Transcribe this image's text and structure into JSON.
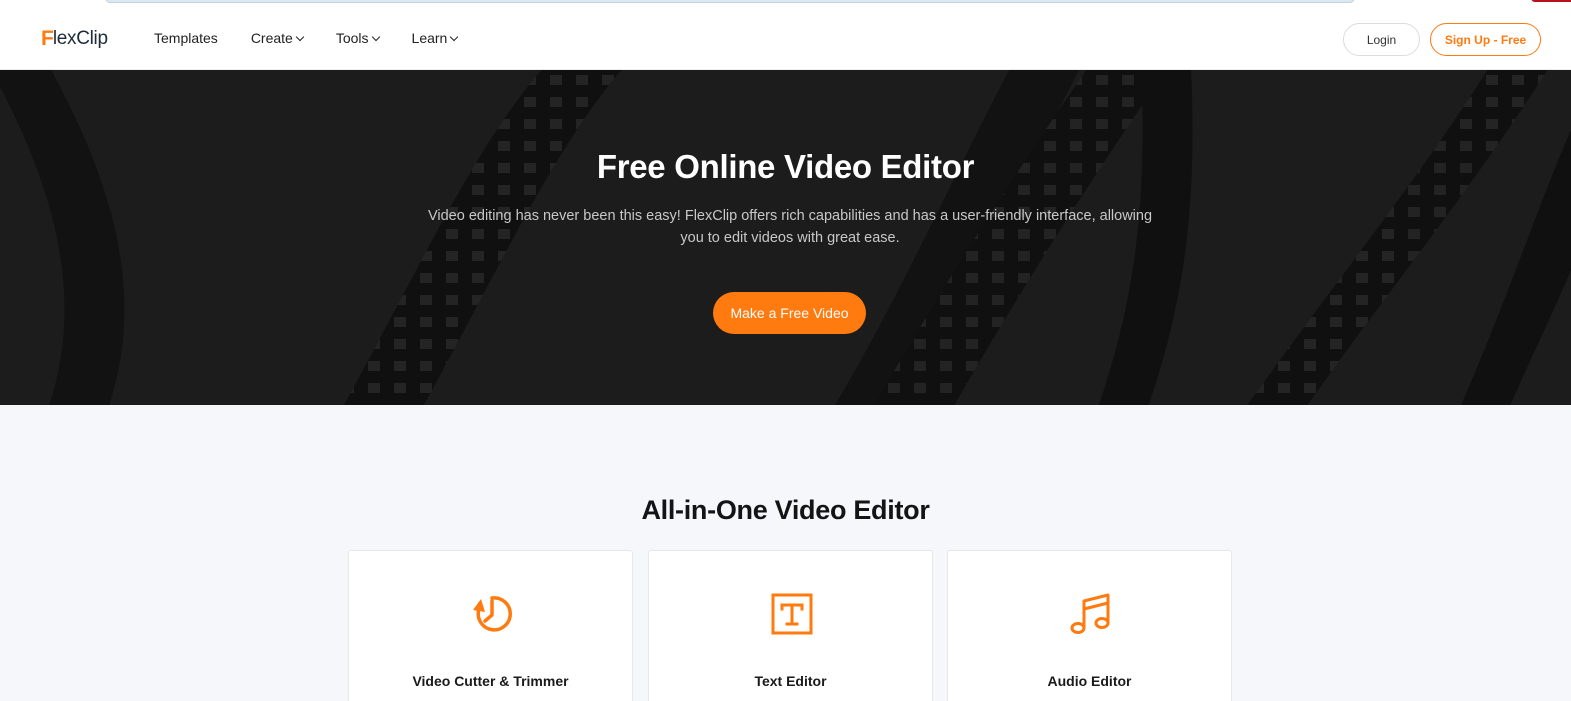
{
  "brand": {
    "logo_mark": "F",
    "logo_text": "lexClip",
    "accent_color": "#ff7a0f"
  },
  "nav": {
    "items": [
      {
        "label": "Templates",
        "has_dropdown": false
      },
      {
        "label": "Create",
        "has_dropdown": true
      },
      {
        "label": "Tools",
        "has_dropdown": true
      },
      {
        "label": "Learn",
        "has_dropdown": true
      }
    ],
    "login_label": "Login",
    "signup_label": "Sign Up - Free"
  },
  "hero": {
    "title": "Free Online Video Editor",
    "description": "Video editing has never been this easy! FlexClip offers rich capabilities and has a user-friendly interface, allowing you to edit videos with great ease.",
    "cta_label": "Make a Free Video"
  },
  "features": {
    "title": "All-in-One Video Editor",
    "cards": [
      {
        "label": "Video Cutter & Trimmer",
        "icon": "clock-rewind-icon"
      },
      {
        "label": "Text Editor",
        "icon": "text-box-icon"
      },
      {
        "label": "Audio Editor",
        "icon": "music-note-icon"
      }
    ]
  }
}
